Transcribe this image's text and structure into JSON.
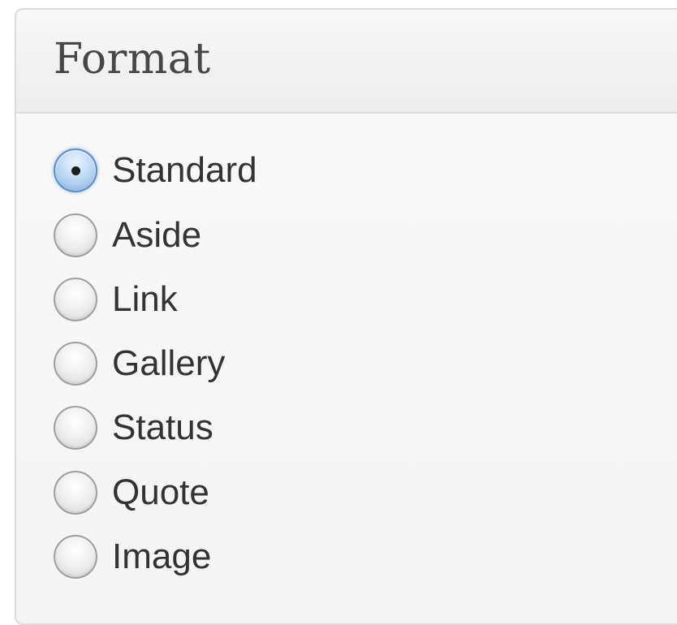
{
  "metabox": {
    "title": "Format"
  },
  "formats": [
    {
      "label": "Standard",
      "checked": true
    },
    {
      "label": "Aside",
      "checked": false
    },
    {
      "label": "Link",
      "checked": false
    },
    {
      "label": "Gallery",
      "checked": false
    },
    {
      "label": "Status",
      "checked": false
    },
    {
      "label": "Quote",
      "checked": false
    },
    {
      "label": "Image",
      "checked": false
    }
  ],
  "colors": {
    "selected_radio": "#7fa9d8",
    "label_text": "#333333",
    "title_text": "#464646"
  }
}
